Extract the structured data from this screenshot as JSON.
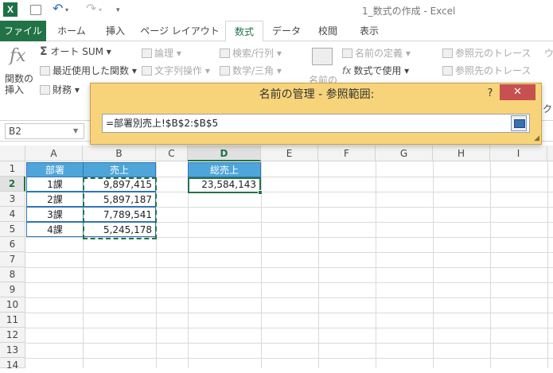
{
  "titlebar": {
    "logo": "X",
    "title": "1_数式の作成 - Excel",
    "undo": "↶",
    "redo": "↷",
    "save_icon": "save-icon"
  },
  "tabs": [
    "ファイル",
    "ホーム",
    "挿入",
    "ページ レイアウト",
    "数式",
    "データ",
    "校閲",
    "表示"
  ],
  "active_tab": "数式",
  "ribbon": {
    "insert_function": "関数の\n挿入",
    "autosum": "オート SUM",
    "recent": "最近使用した関数",
    "finance": "財務",
    "logic": "論理",
    "text": "文字列操作",
    "lookup": "検索/行列",
    "math": "数学/三角",
    "name_define": "名前の定義",
    "use_in_formula": "数式で使用",
    "name_manager": "名前の",
    "trace_precedents": "参照元のトレース",
    "trace_dependents": "参照先のトレース",
    "watch": "ウ",
    "calc": "クシ"
  },
  "namebox": {
    "value": "B2"
  },
  "columns": [
    "A",
    "B",
    "C",
    "D",
    "E",
    "F",
    "G",
    "H",
    "I"
  ],
  "rows": [
    "1",
    "2",
    "3",
    "4",
    "5",
    "6",
    "7",
    "8",
    "9",
    "10",
    "11",
    "12",
    "13",
    "14"
  ],
  "selected_column": "D",
  "selected_row": "2",
  "table": {
    "header_dept": "部署",
    "header_sales": "売上",
    "rows": [
      {
        "dept": "1課",
        "sales": "9,897,415"
      },
      {
        "dept": "2課",
        "sales": "5,897,187"
      },
      {
        "dept": "3課",
        "sales": "7,789,541"
      },
      {
        "dept": "4課",
        "sales": "5,245,178"
      }
    ],
    "total_header": "総売上",
    "total_value": "23,584,143"
  },
  "dialog": {
    "title": "名前の管理 - 参照範囲:",
    "help": "?",
    "close": "✕",
    "input_value": "=部署別売上!$B$2:$B$5"
  },
  "colors": {
    "accent": "#217346",
    "header_fill": "#4ea5d9",
    "dialog_bg": "#f7d47a",
    "close_red": "#c75050"
  }
}
